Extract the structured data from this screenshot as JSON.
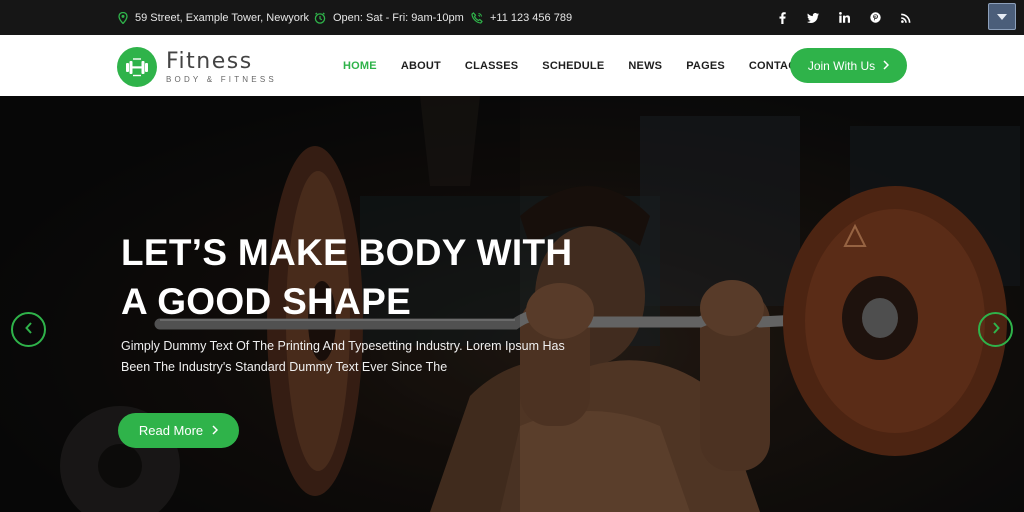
{
  "topbar": {
    "address": "59 Street, Example Tower, Newyork",
    "hours": "Open: Sat - Fri: 9am-10pm",
    "phone": "+11 123 456 789",
    "social": [
      "facebook-icon",
      "twitter-icon",
      "linkedin-icon",
      "pinterest-icon",
      "rss-icon"
    ],
    "corner_button_icon": "triangle-down-icon"
  },
  "header": {
    "logo_title": "Fitness",
    "logo_subtitle": "BODY & FITNESS",
    "nav": [
      "HOME",
      "ABOUT",
      "CLASSES",
      "SCHEDULE",
      "NEWS",
      "PAGES",
      "CONTACT"
    ],
    "active_nav": "HOME",
    "cta_label": "Join With Us"
  },
  "hero": {
    "title_line1": "LET’S MAKE BODY WITH",
    "title_line2": "A GOOD SHAPE",
    "description": "Gimply Dummy Text Of The Printing And Typesetting Industry. Lorem Ipsum Has Been The Industry's Standard Dummy Text Ever Since The",
    "button_label": "Read More"
  },
  "colors": {
    "accent": "#2fb34a",
    "topbar_bg": "#161616",
    "header_bg": "#ffffff"
  }
}
